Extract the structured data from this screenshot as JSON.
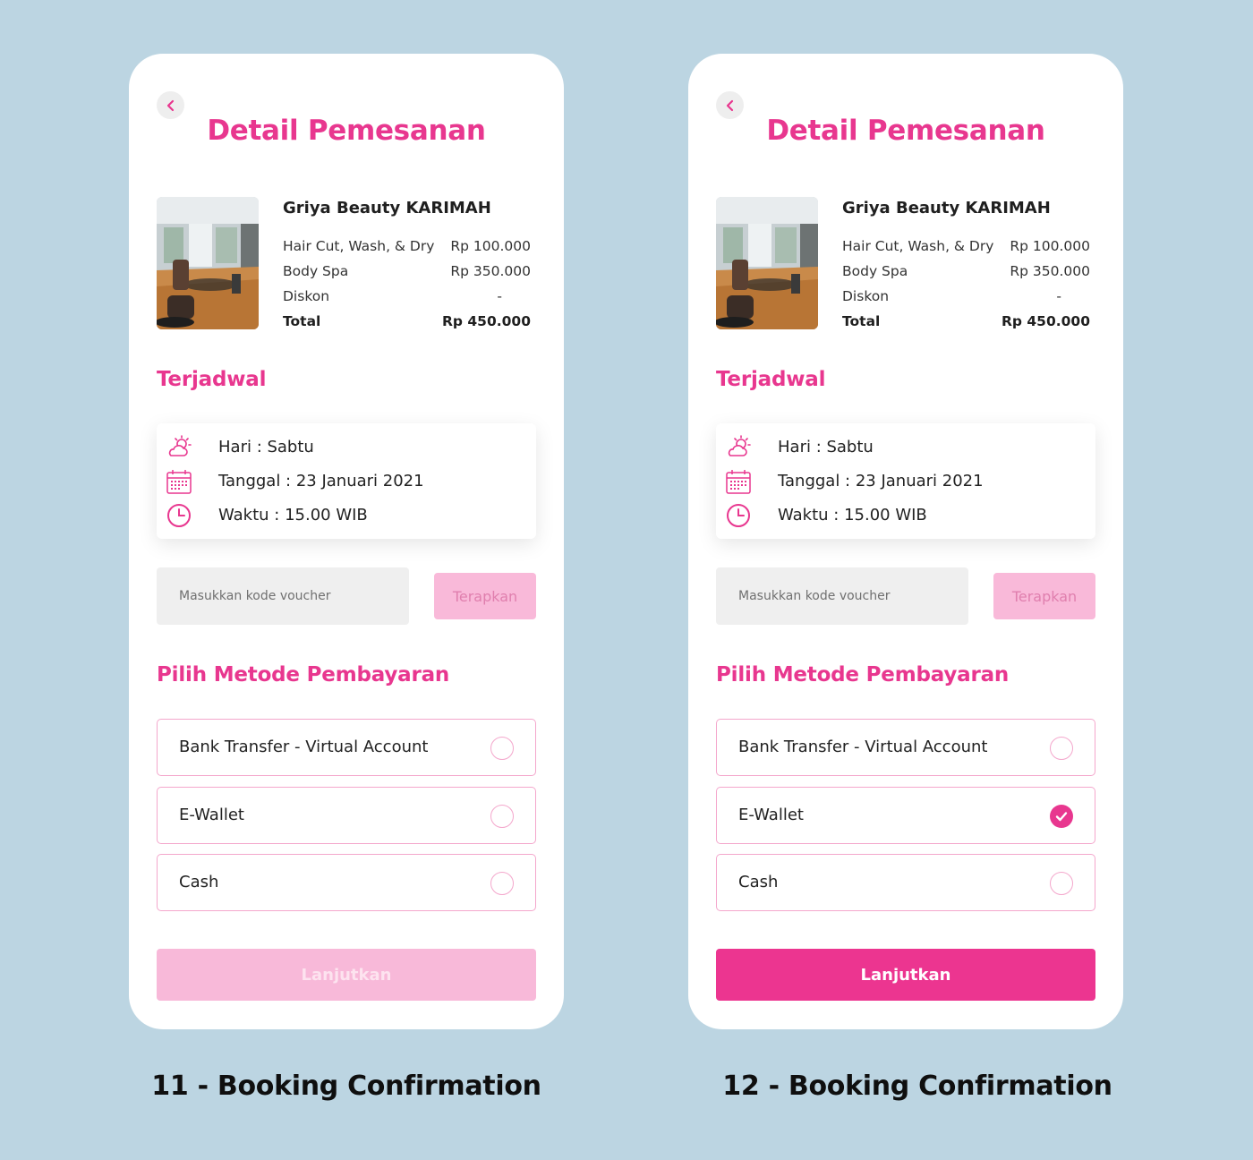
{
  "colors": {
    "accent": "#e8378f",
    "accent_light": "#f9b9d9",
    "border_pink": "#f4a7cc",
    "background": "#bcd5e2"
  },
  "screens": [
    {
      "title": "Detail Pemesanan",
      "back_icon": "chevron-left-icon",
      "salon": {
        "name": "Griya Beauty KARIMAH",
        "items": [
          {
            "label": "Hair Cut, Wash, & Dry",
            "value": "Rp 100.000"
          },
          {
            "label": "Body Spa",
            "value": "Rp 350.000"
          },
          {
            "label": "Diskon",
            "value": "-"
          }
        ],
        "total": {
          "label": "Total",
          "value": "Rp 450.000"
        }
      },
      "schedule_title": "Terjadwal",
      "schedule": [
        {
          "icon": "weather-icon",
          "text": "Hari : Sabtu"
        },
        {
          "icon": "calendar-icon",
          "text": "Tanggal : 23 Januari 2021"
        },
        {
          "icon": "clock-icon",
          "text": "Waktu : 15.00 WIB"
        }
      ],
      "voucher": {
        "placeholder": "Masukkan kode voucher",
        "value": "",
        "apply_label": "Terapkan"
      },
      "payment_title": "Pilih Metode Pembayaran",
      "payment_options": [
        {
          "label": "Bank Transfer - Virtual Account",
          "selected": false
        },
        {
          "label": "E-Wallet",
          "selected": false
        },
        {
          "label": "Cash",
          "selected": false
        }
      ],
      "continue_label": "Lanjutkan",
      "continue_enabled": false,
      "caption": "11 - Booking Confirmation"
    },
    {
      "title": "Detail Pemesanan",
      "back_icon": "chevron-left-icon",
      "salon": {
        "name": "Griya Beauty KARIMAH",
        "items": [
          {
            "label": "Hair Cut, Wash, & Dry",
            "value": "Rp 100.000"
          },
          {
            "label": "Body Spa",
            "value": "Rp 350.000"
          },
          {
            "label": "Diskon",
            "value": "-"
          }
        ],
        "total": {
          "label": "Total",
          "value": "Rp 450.000"
        }
      },
      "schedule_title": "Terjadwal",
      "schedule": [
        {
          "icon": "weather-icon",
          "text": "Hari : Sabtu"
        },
        {
          "icon": "calendar-icon",
          "text": "Tanggal : 23 Januari 2021"
        },
        {
          "icon": "clock-icon",
          "text": "Waktu : 15.00 WIB"
        }
      ],
      "voucher": {
        "placeholder": "Masukkan kode voucher",
        "value": "",
        "apply_label": "Terapkan"
      },
      "payment_title": "Pilih Metode Pembayaran",
      "payment_options": [
        {
          "label": "Bank Transfer - Virtual Account",
          "selected": false
        },
        {
          "label": "E-Wallet",
          "selected": true
        },
        {
          "label": "Cash",
          "selected": false
        }
      ],
      "continue_label": "Lanjutkan",
      "continue_enabled": true,
      "caption": "12 - Booking Confirmation"
    }
  ]
}
